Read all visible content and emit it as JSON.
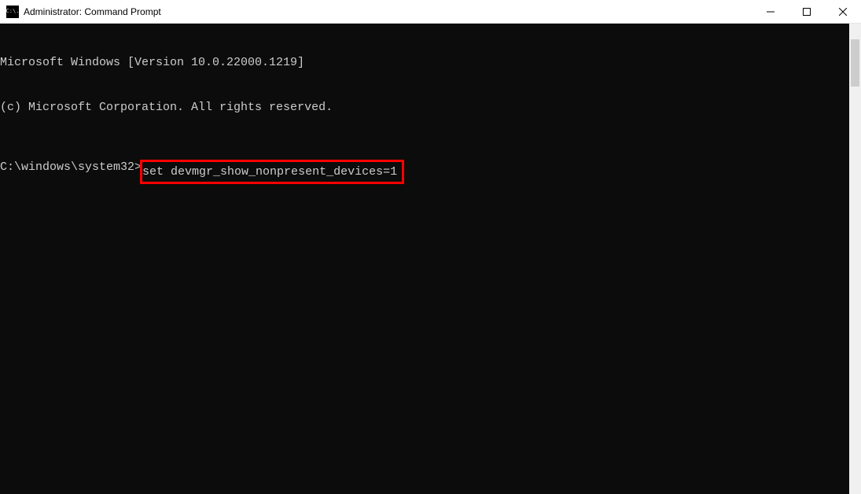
{
  "window": {
    "title": "Administrator: Command Prompt",
    "icon_text": "C:\\."
  },
  "terminal": {
    "line1": "Microsoft Windows [Version 10.0.22000.1219]",
    "line2": "(c) Microsoft Corporation. All rights reserved.",
    "prompt": "C:\\windows\\system32>",
    "command": "set devmgr_show_nonpresent_devices=1"
  },
  "highlight": {
    "color": "#ff0000"
  }
}
